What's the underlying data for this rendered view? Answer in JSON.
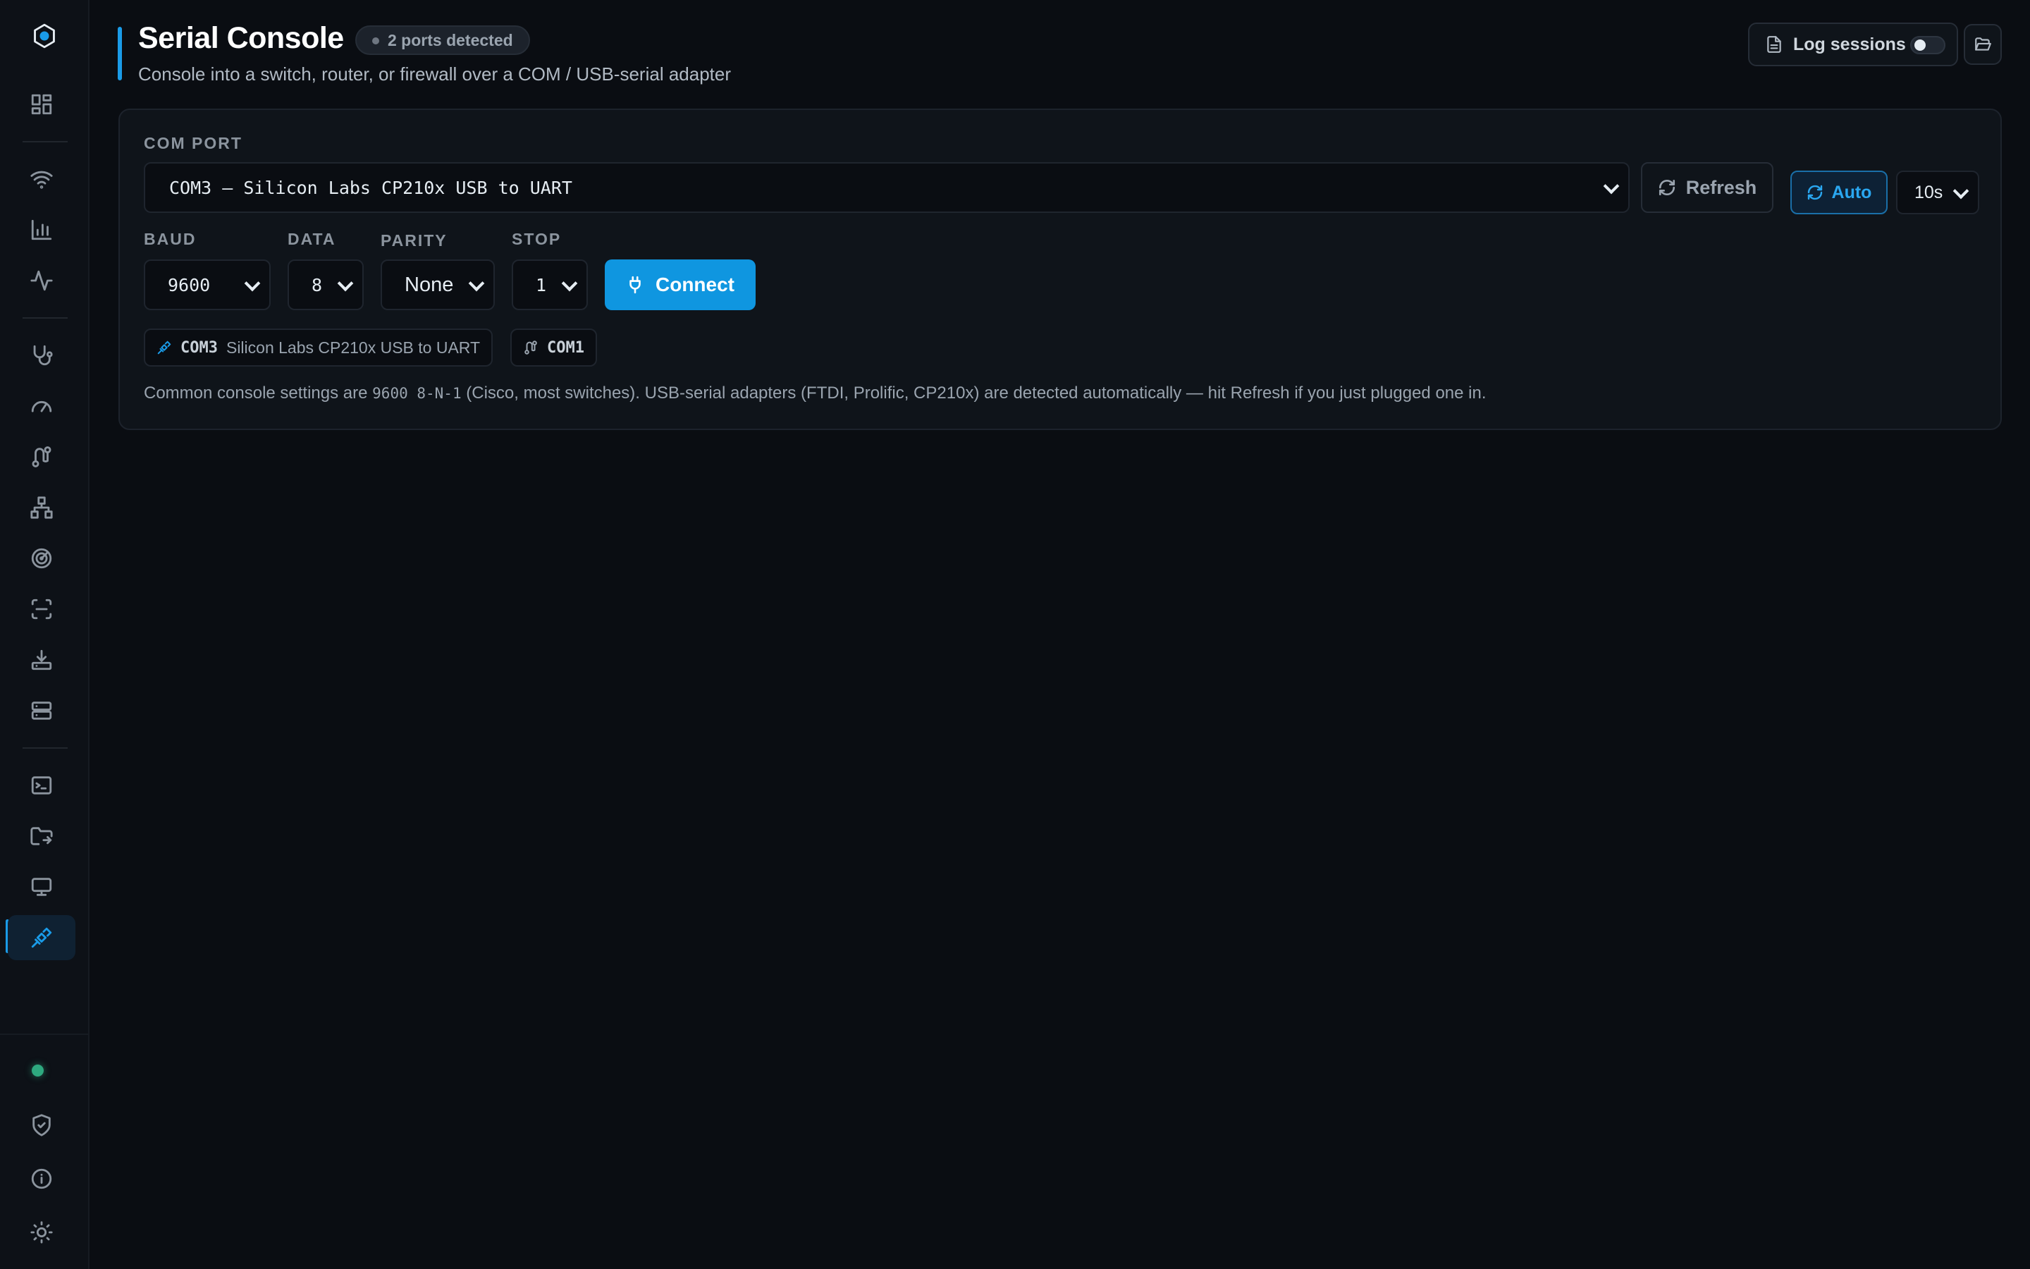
{
  "sidebar": {
    "items": [
      {
        "name": "dashboard-icon"
      },
      {
        "name": "wifi-icon"
      },
      {
        "name": "bar-chart-icon"
      },
      {
        "name": "activity-icon"
      },
      {
        "name": "stethoscope-icon"
      },
      {
        "name": "gauge-icon"
      },
      {
        "name": "route-icon"
      },
      {
        "name": "network-icon"
      },
      {
        "name": "radar-icon"
      },
      {
        "name": "scan-icon"
      },
      {
        "name": "download-icon"
      },
      {
        "name": "server-icon"
      },
      {
        "name": "terminal-icon"
      },
      {
        "name": "folder-sync-icon"
      },
      {
        "name": "monitor-icon"
      },
      {
        "name": "serial-cable-icon",
        "active": true
      }
    ],
    "bottom": [
      {
        "name": "shield-check-icon"
      },
      {
        "name": "info-icon"
      },
      {
        "name": "sun-icon"
      }
    ],
    "status_color": "#2ea97f"
  },
  "header": {
    "title": "Serial Console",
    "badge": "2 ports detected",
    "subtitle": "Console into a switch, router, or firewall over a COM / USB-serial adapter",
    "log_sessions_label": "Log sessions",
    "log_sessions_enabled": false
  },
  "connection": {
    "com_port_label": "COM PORT",
    "com_port_value": "COM3 — Silicon Labs CP210x USB to UART",
    "refresh_label": "Refresh",
    "auto_label": "Auto",
    "auto_interval": "10s",
    "baud_label": "BAUD",
    "baud_value": "9600",
    "data_label": "DATA",
    "data_value": "8",
    "parity_label": "PARITY",
    "parity_value": "None",
    "stop_label": "STOP",
    "stop_value": "1",
    "connect_label": "Connect"
  },
  "detected_ports": [
    {
      "port": "COM3",
      "description": "Silicon Labs CP210x USB to UART"
    },
    {
      "port": "COM1",
      "description": ""
    }
  ],
  "hint": {
    "prefix": "Common console settings are ",
    "code": "9600 8-N-1",
    "suffix": " (Cisco, most switches). USB-serial adapters (FTDI, Prolific, CP210x) are detected automatically — hit Refresh if you just plugged one in."
  },
  "colors": {
    "accent": "#1a9be8",
    "connect": "#0f96e0",
    "background": "#0a0d12"
  }
}
